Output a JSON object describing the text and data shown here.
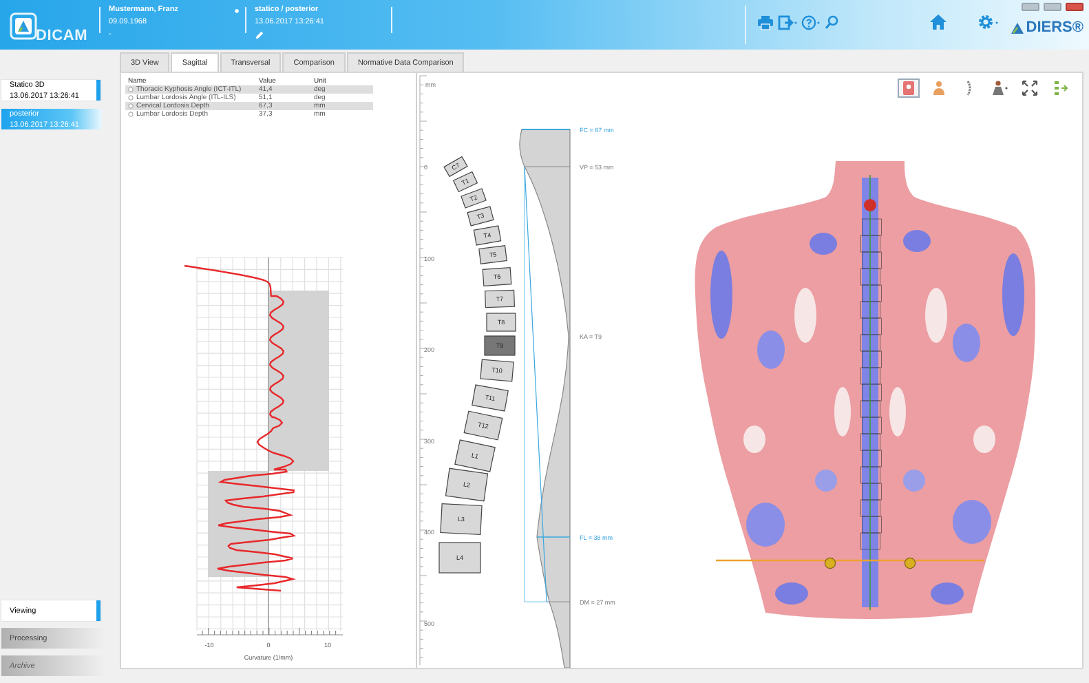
{
  "header": {
    "app_name": "DICAM",
    "patient": {
      "name": "Mustermann, Franz",
      "birth_date": "09.09.1968",
      "extra": "-"
    },
    "recording": {
      "title": "statico / posterior",
      "timestamp": "13.06.2017 13:26:41"
    },
    "brand": "DIERS®"
  },
  "sidebar": {
    "recordings": [
      {
        "title": "Statico 3D",
        "timestamp": "13.06.2017 13:26:41",
        "selected": false
      },
      {
        "title": "posterior",
        "timestamp": "13.06.2017 13:26:41",
        "selected": true
      }
    ],
    "modes": [
      {
        "label": "Viewing",
        "selected": true,
        "disabled": false
      },
      {
        "label": "Processing",
        "selected": false,
        "disabled": false
      },
      {
        "label": "Archive",
        "selected": false,
        "disabled": true
      }
    ]
  },
  "tabs": [
    {
      "label": "3D View",
      "selected": false
    },
    {
      "label": "Sagittal",
      "selected": true
    },
    {
      "label": "Transversal",
      "selected": false
    },
    {
      "label": "Comparison",
      "selected": false
    },
    {
      "label": "Normative Data Comparison",
      "selected": false
    }
  ],
  "parameters_table": {
    "columns": [
      "Name",
      "Value",
      "Unit"
    ],
    "rows": [
      {
        "name": "Thoracic Kyphosis Angle (ICT-ITL)",
        "value": "41,4",
        "unit": "deg",
        "selected": true
      },
      {
        "name": "Lumbar Lordosis Angle (ITL-ILS)",
        "value": "51,1",
        "unit": "deg",
        "selected": false
      },
      {
        "name": "Cervical Lordosis Depth",
        "value": "67,3",
        "unit": "mm",
        "selected": true
      },
      {
        "name": "Lumbar Lordosis Depth",
        "value": "37,3",
        "unit": "mm",
        "selected": false
      }
    ]
  },
  "curvature_plot": {
    "xticks": [
      "-10",
      "0",
      "10"
    ],
    "xlabel": "Curvature (1/mm)"
  },
  "spine_profile": {
    "scale_unit": "mm",
    "scale_labels": [
      "0",
      "100",
      "200",
      "300",
      "400",
      "500"
    ],
    "vertebrae": [
      {
        "label": "C7",
        "highlighted": false
      },
      {
        "label": "T1",
        "highlighted": false
      },
      {
        "label": "T2",
        "highlighted": false
      },
      {
        "label": "T3",
        "highlighted": false
      },
      {
        "label": "T4",
        "highlighted": false
      },
      {
        "label": "T5",
        "highlighted": false
      },
      {
        "label": "T6",
        "highlighted": false
      },
      {
        "label": "T7",
        "highlighted": false
      },
      {
        "label": "T8",
        "highlighted": false
      },
      {
        "label": "T9",
        "highlighted": true
      },
      {
        "label": "T10",
        "highlighted": false
      },
      {
        "label": "T11",
        "highlighted": false
      },
      {
        "label": "T12",
        "highlighted": false
      },
      {
        "label": "L1",
        "highlighted": false
      },
      {
        "label": "L2",
        "highlighted": false
      },
      {
        "label": "L3",
        "highlighted": false
      },
      {
        "label": "L4",
        "highlighted": false
      }
    ],
    "annotations": [
      {
        "kind": "plumb",
        "text": "FC = 67 mm"
      },
      {
        "kind": "level",
        "text": "VP = 53 mm"
      },
      {
        "kind": "level",
        "text": "KA = T9"
      },
      {
        "kind": "plumb",
        "text": "FL = 38 mm"
      },
      {
        "kind": "level",
        "text": "DM = 27 mm"
      }
    ]
  },
  "view_toolbar": {
    "tools": [
      {
        "kind": "surface",
        "selected": true
      },
      {
        "kind": "body",
        "selected": false
      },
      {
        "kind": "spine",
        "selected": false
      },
      {
        "kind": "figure",
        "selected": false
      },
      {
        "kind": "fit",
        "selected": false
      },
      {
        "kind": "layers",
        "selected": false
      }
    ]
  }
}
